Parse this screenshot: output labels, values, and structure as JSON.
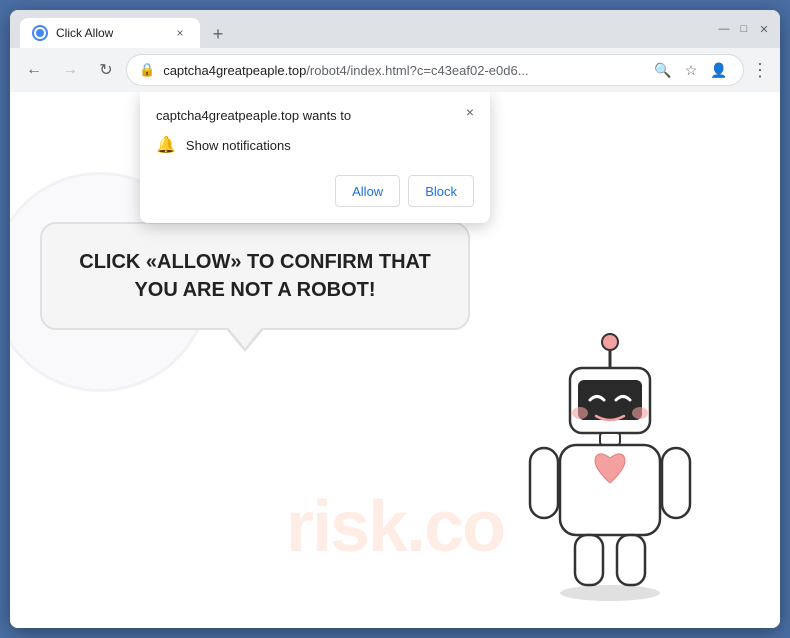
{
  "browser": {
    "tab_title": "Click Allow",
    "tab_close_label": "×",
    "new_tab_label": "+",
    "controls": {
      "minimize": "—",
      "maximize": "□",
      "close": "✕"
    },
    "nav": {
      "back": "←",
      "forward": "→",
      "refresh": "↻"
    },
    "address": {
      "domain": "captcha4greatpeaple.top",
      "path": "/robot4/index.html?c=c43eaf02-e0d6..."
    }
  },
  "permission_popup": {
    "title": "captcha4greatpeaple.top wants to",
    "close_label": "×",
    "notification_label": "Show notifications",
    "allow_label": "Allow",
    "block_label": "Block"
  },
  "page": {
    "captcha_text": "CLICK «ALLOW» TO CONFIRM THAT YOU ARE NOT A ROBOT!",
    "watermark": "risk.co"
  }
}
